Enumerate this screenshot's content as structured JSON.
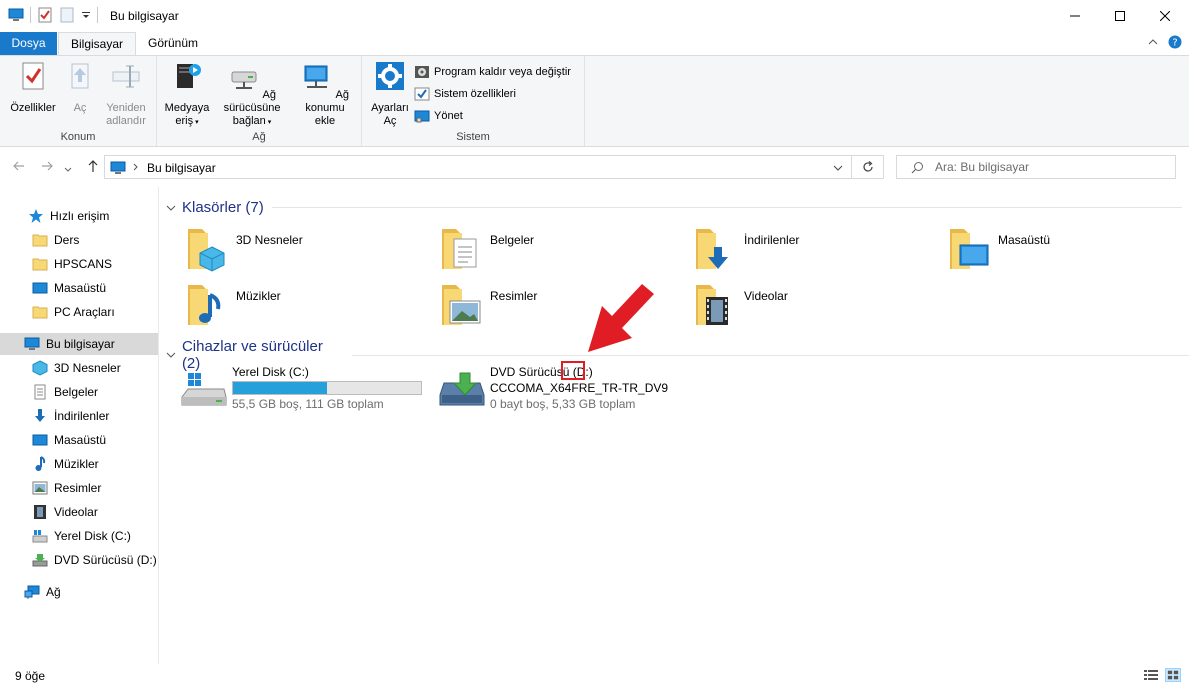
{
  "window": {
    "title": "Bu bilgisayar"
  },
  "tabs": {
    "file": "Dosya",
    "computer": "Bilgisayar",
    "view": "Görünüm"
  },
  "ribbon": {
    "groups": {
      "location": "Konum",
      "network": "Ağ",
      "system": "Sistem"
    },
    "buttons": {
      "properties": "Özellikler",
      "open": "Aç",
      "rename_1": "Yeniden",
      "rename_2": "adlandır",
      "media_1": "Medyaya",
      "media_2": "eriş",
      "map_drive_1": "Ağ sürücüsüne",
      "map_drive_2": "bağlan",
      "add_location_1": "Ağ konumu",
      "add_location_2": "ekle",
      "settings_1": "Ayarları",
      "settings_2": "Aç",
      "uninstall": "Program kaldır veya değiştir",
      "system_props": "Sistem özellikleri",
      "manage": "Yönet"
    }
  },
  "address": {
    "crumb": "Bu bilgisayar",
    "search_placeholder": "Ara: Bu bilgisayar"
  },
  "navpane": {
    "quick_access": "Hızlı erişim",
    "items_quick": [
      "Ders",
      "HPSCANS",
      "Masaüstü",
      "PC Araçları"
    ],
    "this_pc": "Bu bilgisayar",
    "items_pc": [
      "3D Nesneler",
      "Belgeler",
      "İndirilenler",
      "Masaüstü",
      "Müzikler",
      "Resimler",
      "Videolar",
      "Yerel Disk (C:)",
      "DVD Sürücüsü (D:) C"
    ],
    "network": "Ağ"
  },
  "folders_section": {
    "title": "Klasörler (7)",
    "items": [
      "3D Nesneler",
      "Belgeler",
      "İndirilenler",
      "Masaüstü",
      "Müzikler",
      "Resimler",
      "Videolar"
    ]
  },
  "drives_section": {
    "title": "Cihazlar ve sürücüler (2)",
    "drives": [
      {
        "name": "Yerel Disk (C:)",
        "info": "55,5 GB boş, 111 GB toplam",
        "used_fraction": 0.5
      },
      {
        "name": "DVD Sürücüsü (D:)",
        "label": "CCCOMA_X64FRE_TR-TR_DV9",
        "info": "0 bayt boş, 5,33 GB toplam"
      }
    ]
  },
  "status": {
    "count": "9 öğe"
  },
  "colors": {
    "accent": "#1979ca",
    "bar_fill": "#26a0da",
    "arrow": "#e01c24",
    "section_title": "#1e3287"
  }
}
